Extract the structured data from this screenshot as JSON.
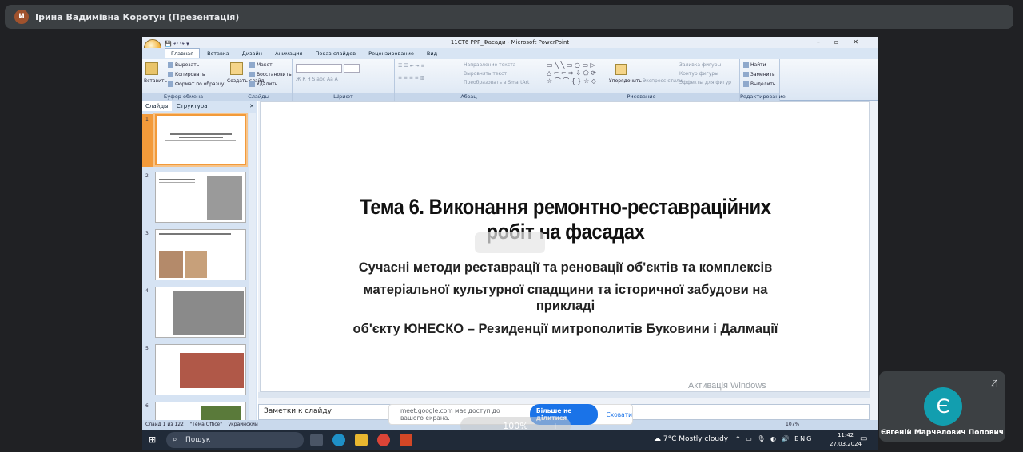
{
  "meet": {
    "presenter_title": "Ірина Вадимівна Коротун (Презентація)",
    "share_notice": "meet.google.com має доступ до вашого екрана.",
    "stop_sharing": "Більше не ділитися",
    "hide": "Сховати",
    "zoom_overlay": "100%",
    "participant_name": "Євгеній Марчелович Попович",
    "participant_initial": "Є"
  },
  "ppt": {
    "window_title": "11СТ6 РРР_Фасади - Microsoft PowerPoint",
    "tabs": [
      "Главная",
      "Вставка",
      "Дизайн",
      "Анимация",
      "Показ слайдов",
      "Рецензирование",
      "Вид"
    ],
    "ribbon": {
      "paste": "Вставить",
      "cut": "Вырезать",
      "copy": "Копировать",
      "format_painter": "Формат по образцу",
      "group_clipboard": "Буфер обмена",
      "create_slide": "Создать слайд",
      "layout": "Макет",
      "reset": "Восстановить",
      "delete": "Удалить",
      "group_slides": "Слайды",
      "group_font": "Шрифт",
      "text_direction": "Направление текста",
      "align_text": "Выровнять текст",
      "smartart": "Преобразовать в SmartArt",
      "group_paragraph": "Абзац",
      "arrange": "Упорядочить",
      "quick_styles": "Экспресс-стили",
      "shape_fill": "Заливка фигуры",
      "shape_outline": "Контур фигуры",
      "shape_effects": "Эффекты для фигур",
      "group_drawing": "Рисование",
      "find": "Найти",
      "replace": "Заменить",
      "select": "Выделить",
      "group_editing": "Редактирование"
    },
    "panel_tabs": [
      "Слайды",
      "Структура"
    ],
    "thumbs": [
      "1",
      "2",
      "3",
      "4",
      "5",
      "6"
    ],
    "slide": {
      "title_line1": "Тема 6. Виконання ремонтно-реставраційних",
      "title_line2": "робіт на фасадах",
      "sub1": "Сучасні методи реставрації та реновації об'єктів та комплексів",
      "sub2": "матеріальної культурної спадщини та історичної забудови на",
      "sub3": "прикладі",
      "sub4": "об'єкту ЮНЕСКО – Резиденції митрополитів Буковини і Далмації"
    },
    "activation_title": "Активація Windows",
    "notes_label": "Заметки к слайду",
    "status": {
      "slide_counter": "Слайд 1 из 122",
      "theme": "\"Тема Office\"",
      "language": "украинский",
      "zoom": "107%"
    }
  },
  "taskbar": {
    "search": "Пошук",
    "weather": "7°C  Mostly cloudy",
    "lang": "ENG",
    "time": "11:42",
    "date": "27.03.2024"
  }
}
